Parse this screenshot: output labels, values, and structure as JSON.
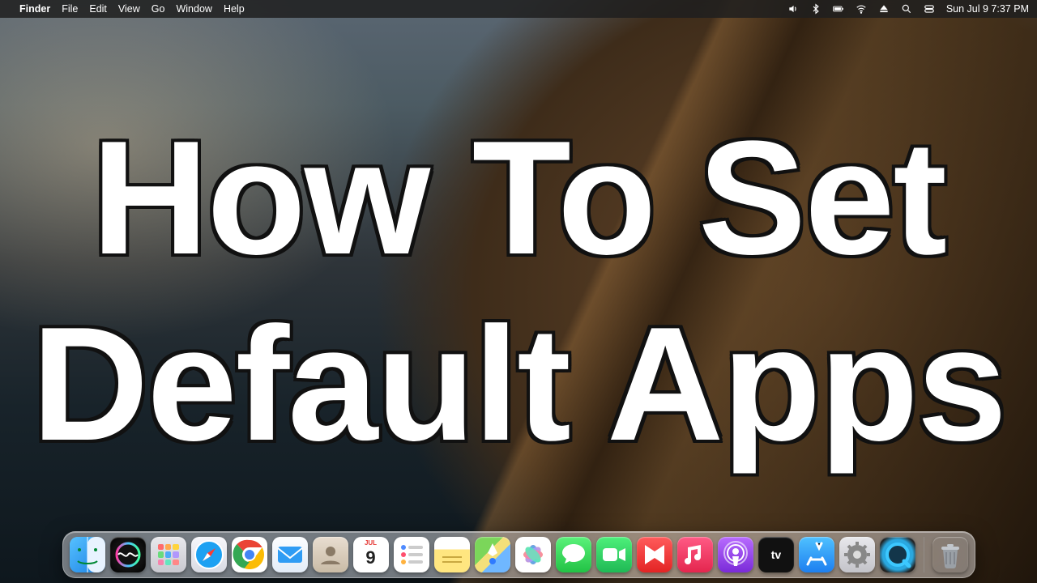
{
  "menubar": {
    "app": "Finder",
    "items": [
      "File",
      "Edit",
      "View",
      "Go",
      "Window",
      "Help"
    ],
    "status": {
      "datetime": "Sun Jul 9  7:37 PM"
    }
  },
  "overlay": {
    "line1": "How To Set",
    "line2": "Default Apps"
  },
  "calendar": {
    "month_abbrev": "JUL",
    "day": "9"
  },
  "dock": {
    "items": [
      {
        "name": "finder",
        "label": "Finder"
      },
      {
        "name": "siri",
        "label": "Siri"
      },
      {
        "name": "launchpad",
        "label": "Launchpad"
      },
      {
        "name": "safari",
        "label": "Safari"
      },
      {
        "name": "chrome",
        "label": "Google Chrome"
      },
      {
        "name": "mail",
        "label": "Mail"
      },
      {
        "name": "contacts",
        "label": "Contacts"
      },
      {
        "name": "calendar",
        "label": "Calendar"
      },
      {
        "name": "reminders",
        "label": "Reminders"
      },
      {
        "name": "notes",
        "label": "Notes"
      },
      {
        "name": "maps",
        "label": "Maps"
      },
      {
        "name": "photos",
        "label": "Photos"
      },
      {
        "name": "messages",
        "label": "Messages"
      },
      {
        "name": "facetime",
        "label": "FaceTime"
      },
      {
        "name": "news",
        "label": "News"
      },
      {
        "name": "music",
        "label": "Music"
      },
      {
        "name": "podcasts",
        "label": "Podcasts"
      },
      {
        "name": "tv",
        "label": "TV"
      },
      {
        "name": "appstore",
        "label": "App Store"
      },
      {
        "name": "settings",
        "label": "System Settings"
      },
      {
        "name": "quicktime",
        "label": "QuickTime Player"
      }
    ],
    "right": [
      {
        "name": "trash",
        "label": "Trash"
      }
    ]
  }
}
